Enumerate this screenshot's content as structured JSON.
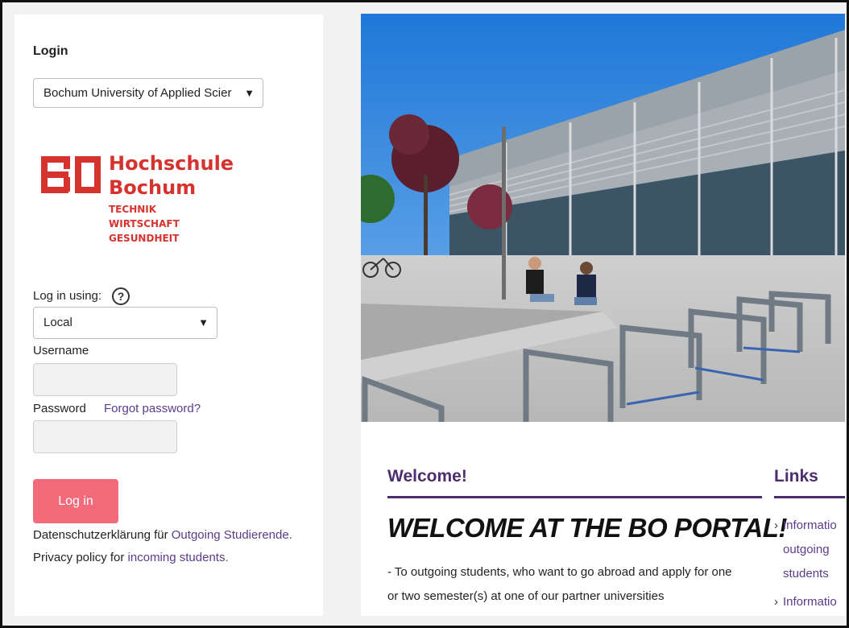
{
  "login": {
    "title": "Login",
    "idp_select_value": "Bochum University of Applied Scier",
    "logo": {
      "mark": "BO",
      "line1": "Hochschule",
      "line2": "Bochum",
      "line3": "TECHNIK",
      "line4": "WIRTSCHAFT",
      "line5": "GESUNDHEIT"
    },
    "log_in_using_label": "Log in using:",
    "help_glyph": "?",
    "auth_method_value": "Local",
    "username_label": "Username",
    "username_value": "",
    "password_label": "Password",
    "password_value": "",
    "forgot_password": "Forgot password?",
    "submit_label": "Log in",
    "privacy_line1_prefix": "Datenschutzerklärung für",
    "privacy_line1_link": "Outgoing Studierende.",
    "privacy_line2_prefix": "Privacy policy for",
    "privacy_line2_link": "incoming students."
  },
  "main": {
    "welcome_heading": "Welcome!",
    "big_heading": "WELCOME AT THE BO PORTAL!",
    "intro_line1": "- To outgoing students, who want to go abroad and apply for one",
    "intro_line2": "or two semester(s) at one of our partner universities",
    "links_heading": "Links",
    "links": [
      {
        "line1": "Informatio",
        "line2": "outgoing",
        "line3": "students"
      },
      {
        "line1": "Informatio"
      }
    ]
  },
  "colors": {
    "accent_purple": "#4d2d6e",
    "link_purple": "#5a3c8a",
    "button_pink": "#f16b7a",
    "logo_red": "#d6332e"
  },
  "icons": {
    "dropdown": "chevron-down-icon",
    "help": "question-circle-icon",
    "link_bullet": "chevron-right-icon"
  }
}
